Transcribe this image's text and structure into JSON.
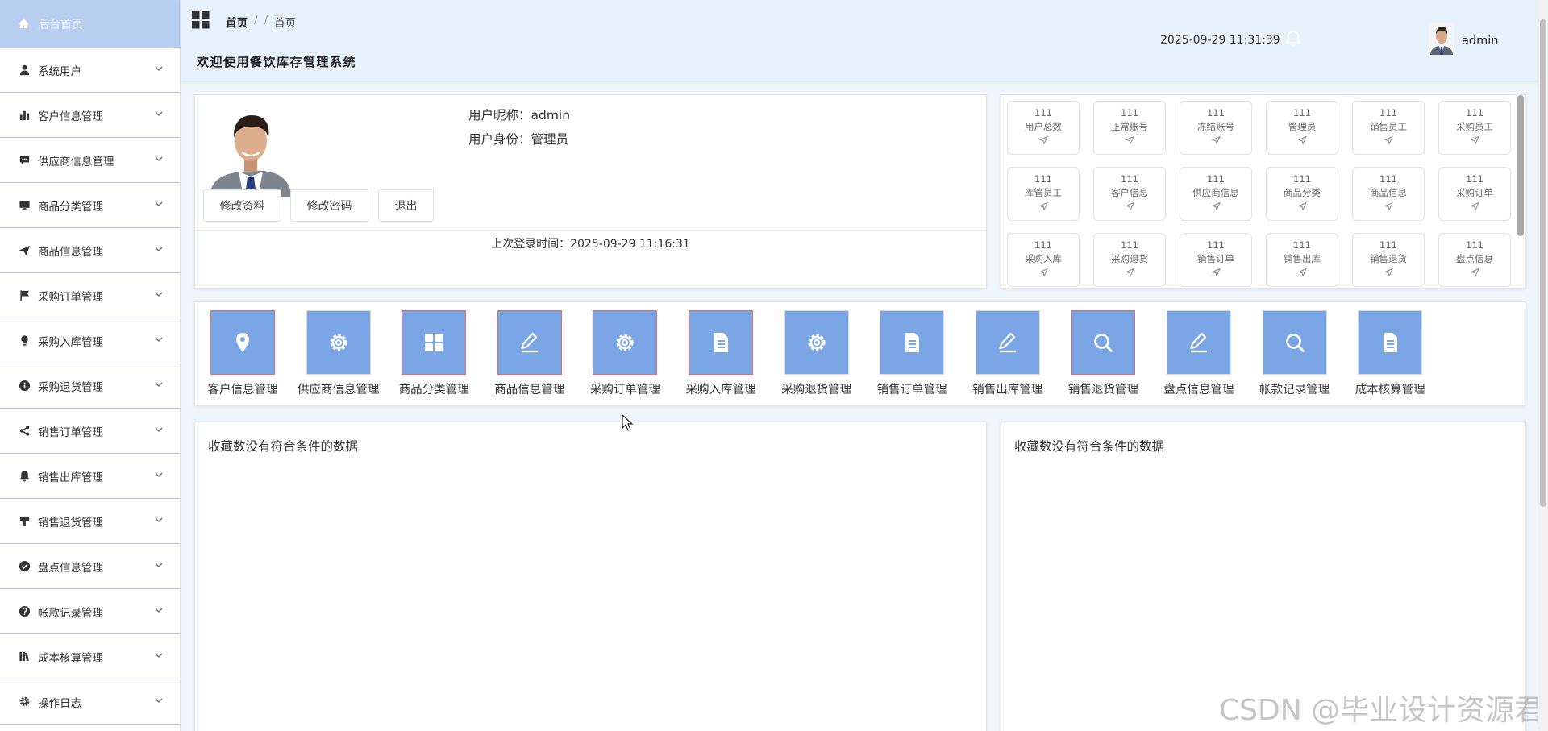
{
  "sidebar": {
    "home_label": "后台首页",
    "items": [
      {
        "label": "系统用户",
        "icon": "user-icon"
      },
      {
        "label": "客户信息管理",
        "icon": "bar-chart-icon"
      },
      {
        "label": "供应商信息管理",
        "icon": "comment-icon"
      },
      {
        "label": "商品分类管理",
        "icon": "monitor-icon"
      },
      {
        "label": "商品信息管理",
        "icon": "send-icon"
      },
      {
        "label": "采购订单管理",
        "icon": "flag-icon"
      },
      {
        "label": "采购入库管理",
        "icon": "bulb-icon"
      },
      {
        "label": "采购退货管理",
        "icon": "info-icon"
      },
      {
        "label": "销售订单管理",
        "icon": "share-icon"
      },
      {
        "label": "销售出库管理",
        "icon": "bell-icon"
      },
      {
        "label": "销售退货管理",
        "icon": "brush-icon"
      },
      {
        "label": "盘点信息管理",
        "icon": "check-circle-icon"
      },
      {
        "label": "帐款记录管理",
        "icon": "question-icon"
      },
      {
        "label": "成本核算管理",
        "icon": "books-icon"
      },
      {
        "label": "操作日志",
        "icon": "gear-icon"
      }
    ]
  },
  "header": {
    "breadcrumb_home": "首页",
    "breadcrumb_sep1": "/",
    "breadcrumb_sep2": "/",
    "breadcrumb_current": "首页",
    "welcome": "欢迎使用餐饮库存管理系统",
    "datetime": "2025-09-29 11:31:39",
    "username": "admin"
  },
  "user_panel": {
    "nickname_line": "用户昵称：admin",
    "role_line": "用户身份：管理员",
    "edit_profile": "修改资料",
    "change_password": "修改密码",
    "logout": "退出",
    "last_login": "上次登录时间：2025-09-29 11:16:31"
  },
  "stats": [
    {
      "value": "111",
      "label": "用户总数"
    },
    {
      "value": "111",
      "label": "正常账号"
    },
    {
      "value": "111",
      "label": "冻结账号"
    },
    {
      "value": "111",
      "label": "管理员"
    },
    {
      "value": "111",
      "label": "销售员工"
    },
    {
      "value": "111",
      "label": "采购员工"
    },
    {
      "value": "111",
      "label": "库管员工"
    },
    {
      "value": "111",
      "label": "客户信息"
    },
    {
      "value": "111",
      "label": "供应商信息"
    },
    {
      "value": "111",
      "label": "商品分类"
    },
    {
      "value": "111",
      "label": "商品信息"
    },
    {
      "value": "111",
      "label": "采购订单"
    },
    {
      "value": "111",
      "label": "采购入库"
    },
    {
      "value": "111",
      "label": "采购退货"
    },
    {
      "value": "111",
      "label": "销售订单"
    },
    {
      "value": "111",
      "label": "销售出库"
    },
    {
      "value": "111",
      "label": "销售退货"
    },
    {
      "value": "111",
      "label": "盘点信息"
    }
  ],
  "quick_access": [
    {
      "label": "客户信息管理",
      "icon": "location-pin-icon"
    },
    {
      "label": "供应商信息管理",
      "icon": "gear-icon"
    },
    {
      "label": "商品分类管理",
      "icon": "grid-icon"
    },
    {
      "label": "商品信息管理",
      "icon": "pencil-icon"
    },
    {
      "label": "采购订单管理",
      "icon": "gear-icon"
    },
    {
      "label": "采购入库管理",
      "icon": "document-icon"
    },
    {
      "label": "采购退货管理",
      "icon": "gear-icon"
    },
    {
      "label": "销售订单管理",
      "icon": "document-icon"
    },
    {
      "label": "销售出库管理",
      "icon": "pencil-icon"
    },
    {
      "label": "销售退货管理",
      "icon": "search-icon"
    },
    {
      "label": "盘点信息管理",
      "icon": "pencil-icon"
    },
    {
      "label": "帐款记录管理",
      "icon": "search-icon"
    },
    {
      "label": "成本核算管理",
      "icon": "document-icon"
    }
  ],
  "favorites": {
    "left_empty": "收藏数没有符合条件的数据",
    "right_empty": "收藏数没有符合条件的数据"
  },
  "watermark": "CSDN @毕业设计资源君",
  "colors": {
    "accent": "#7aa6e6",
    "sidebar_home_bg": "#b7cef0",
    "header_bg": "#e6f1fc",
    "highlight_border": "#e36a6a"
  }
}
